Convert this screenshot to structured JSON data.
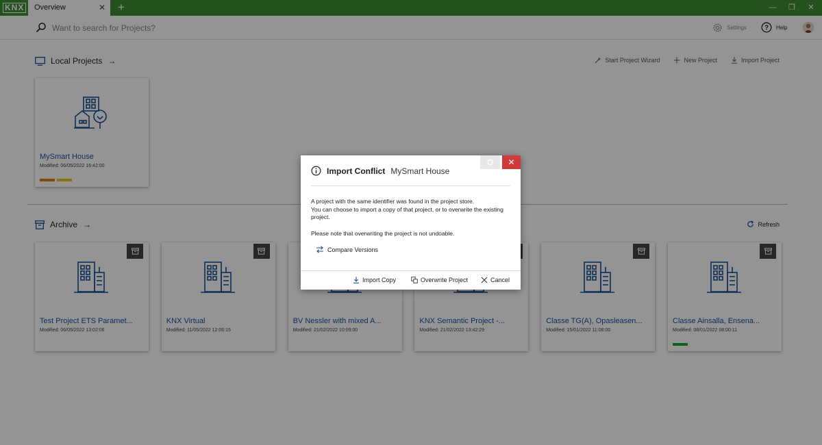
{
  "app": {
    "logo": "KNX",
    "tab_label": "Overview",
    "tab_add": "+",
    "win_minimize": "—",
    "win_maximize": "❐",
    "win_close": "✕"
  },
  "search": {
    "placeholder": "Want to search for Projects?",
    "value": ""
  },
  "header": {
    "settings_label": "Settings",
    "help_label": "Help"
  },
  "local": {
    "title": "Local Projects",
    "arrow": "→",
    "actions": {
      "wizard": "Start Project Wizard",
      "new": "New Project",
      "import": "Import Project"
    },
    "project": {
      "name": "MySmart House",
      "modified": "Modified: 06/05/2022 16:42:00",
      "tags": [
        "#e07a1c",
        "#e6c81b"
      ]
    }
  },
  "archive": {
    "title": "Archive",
    "arrow": "→",
    "refresh": "Refresh",
    "items": [
      {
        "name": "Test Project ETS Paramet...",
        "modified": "Modified: 06/05/2022 13:02:06",
        "tag": ""
      },
      {
        "name": "KNX Virtual",
        "modified": "Modified: 11/05/2022 12:06:15",
        "tag": ""
      },
      {
        "name": "BV Nessler with mixed A...",
        "modified": "Modified: 21/02/2022 10:09:00",
        "tag": ""
      },
      {
        "name": "KNX Semantic Project -...",
        "modified": "Modified: 21/02/2022 13:42:29",
        "tag": ""
      },
      {
        "name": "Classe TG(A), Opasleasen...",
        "modified": "Modified: 15/01/2022 11:08:00",
        "tag": ""
      },
      {
        "name": "Classe Ainsalla, Ensena...",
        "modified": "Modified: 08/01/2022 08:00:11",
        "tag": "#21a33a"
      }
    ]
  },
  "dialog": {
    "title": "Import Conflict",
    "project": "MySmart House",
    "line1": "A project with the same identifier was found in the project store.",
    "line2": "You can choose to import a copy of that project, or to overwrite the existing project.",
    "note": "Please note that overwriting the project is not undoable.",
    "compare": "Compare Versions",
    "import_copy": "Import Copy",
    "overwrite": "Overwrite Project",
    "cancel": "Cancel",
    "close": "✕"
  },
  "colors": {
    "brand_green": "#3e8e32",
    "link_blue": "#1b4f9a",
    "close_red": "#d23a3a"
  }
}
